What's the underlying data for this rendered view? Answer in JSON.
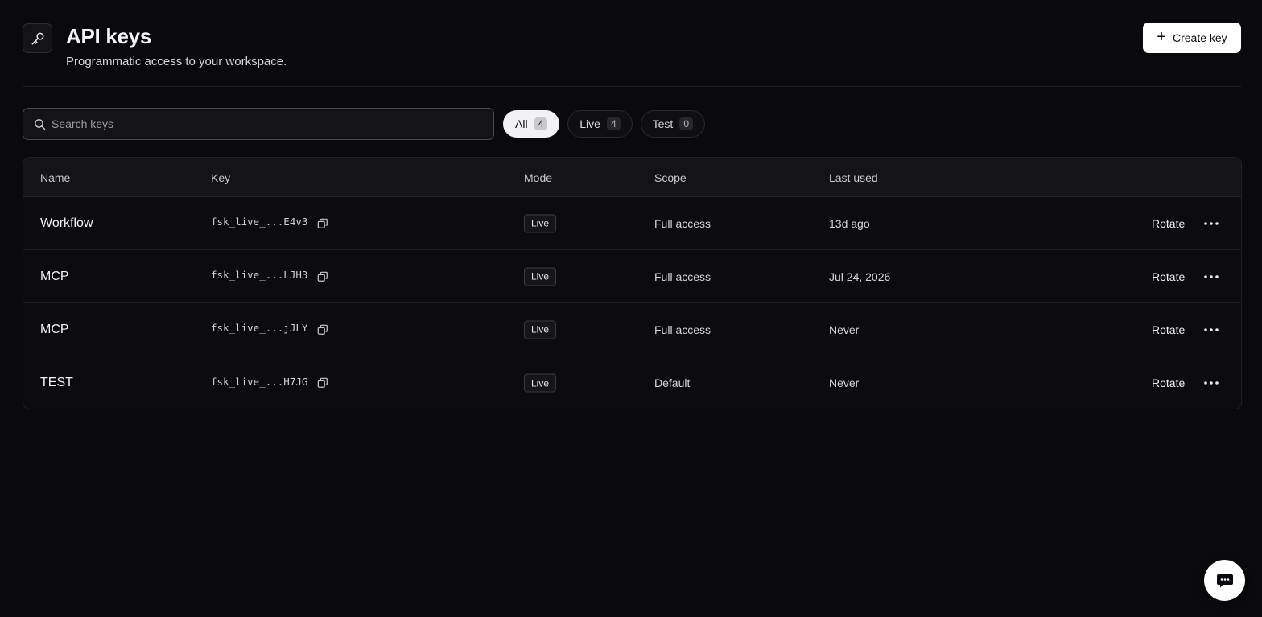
{
  "header": {
    "title": "API keys",
    "subtitle": "Programmatic access to your workspace.",
    "icon": "key-icon",
    "create_label": "Create key"
  },
  "search": {
    "placeholder": "Search keys",
    "value": ""
  },
  "filters": [
    {
      "label": "All",
      "count": "4",
      "active": true
    },
    {
      "label": "Live",
      "count": "4",
      "active": false
    },
    {
      "label": "Test",
      "count": "0",
      "active": false
    }
  ],
  "table": {
    "columns": [
      "Name",
      "Key",
      "Mode",
      "Scope",
      "Last used"
    ],
    "rows": [
      {
        "name": "Workflow",
        "key": "fsk_live_...E4v3",
        "mode": "Live",
        "scope": "Full access",
        "last_used": "13d ago",
        "action": "Rotate"
      },
      {
        "name": "MCP",
        "key": "fsk_live_...LJH3",
        "mode": "Live",
        "scope": "Full access",
        "last_used": "Jul 24, 2026",
        "action": "Rotate"
      },
      {
        "name": "MCP",
        "key": "fsk_live_...jJLY",
        "mode": "Live",
        "scope": "Full access",
        "last_used": "Never",
        "action": "Rotate"
      },
      {
        "name": "TEST",
        "key": "fsk_live_...H7JG",
        "mode": "Live",
        "scope": "Default",
        "last_used": "Never",
        "action": "Rotate"
      }
    ]
  },
  "chat": {
    "icon": "chat-icon"
  },
  "colors": {
    "background": "#0a0a0c",
    "primary_button": "#ffffff",
    "active_chip": "#f2f2f4"
  }
}
